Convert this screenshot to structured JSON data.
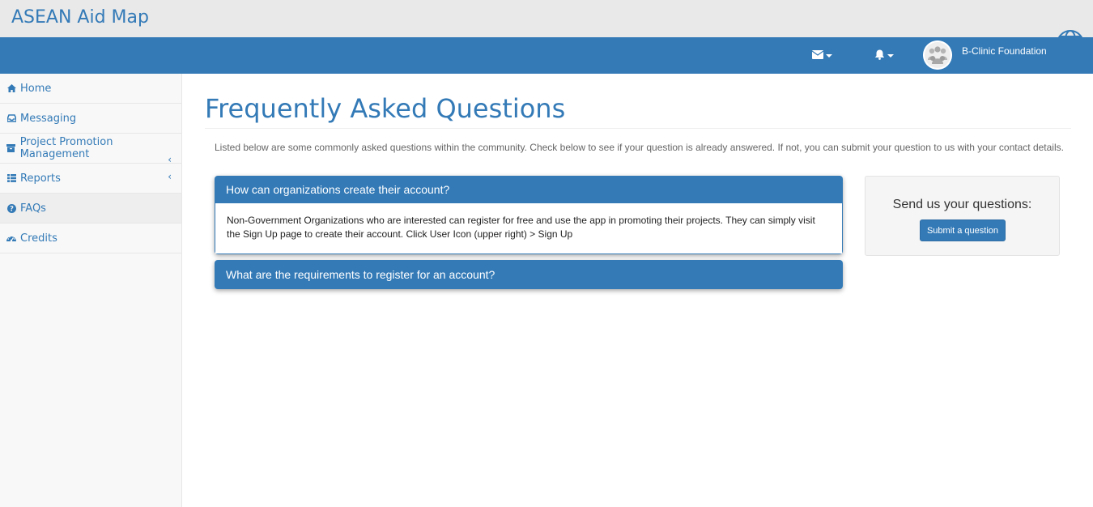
{
  "app": {
    "title": "ASEAN Aid Map"
  },
  "navbar": {
    "messages_icon": "envelope-icon",
    "notifications_icon": "bell-icon",
    "user": {
      "name": "B-Clinic Foundation",
      "avatar_icon": "users-avatar-icon"
    }
  },
  "sidebar": {
    "items": [
      {
        "label": "Home",
        "icon": "home-icon"
      },
      {
        "label": "Messaging",
        "icon": "inbox-icon"
      },
      {
        "label": "Project Promotion Management",
        "icon": "archive-icon",
        "chevron": "‹"
      },
      {
        "label": "Reports",
        "icon": "table-icon",
        "chevron": "‹"
      },
      {
        "label": "FAQs",
        "icon": "question-circle-icon",
        "active": true
      },
      {
        "label": "Credits",
        "icon": "dashboard-icon"
      }
    ]
  },
  "main": {
    "title": "Frequently Asked Questions",
    "intro": "Listed below are some commonly asked questions within the community. Check below to see if your question is already answered. If not, you can submit your question to us with your contact details.",
    "faqs": [
      {
        "question": "How can organizations create their account?",
        "answer": "Non-Government Organizations who are interested can register for free and use the app in promoting their projects. They can simply visit the Sign Up page to create their account. Click User Icon (upper right) > Sign Up",
        "expanded": true
      },
      {
        "question": "What are the requirements to register for an account?",
        "expanded": false
      }
    ],
    "contact": {
      "title": "Send us your questions:",
      "button_label": "Submit a question"
    }
  },
  "colors": {
    "brand": "#337ab7",
    "topbar": "#e9e9e9",
    "sidebar": "#f8f8f8"
  }
}
